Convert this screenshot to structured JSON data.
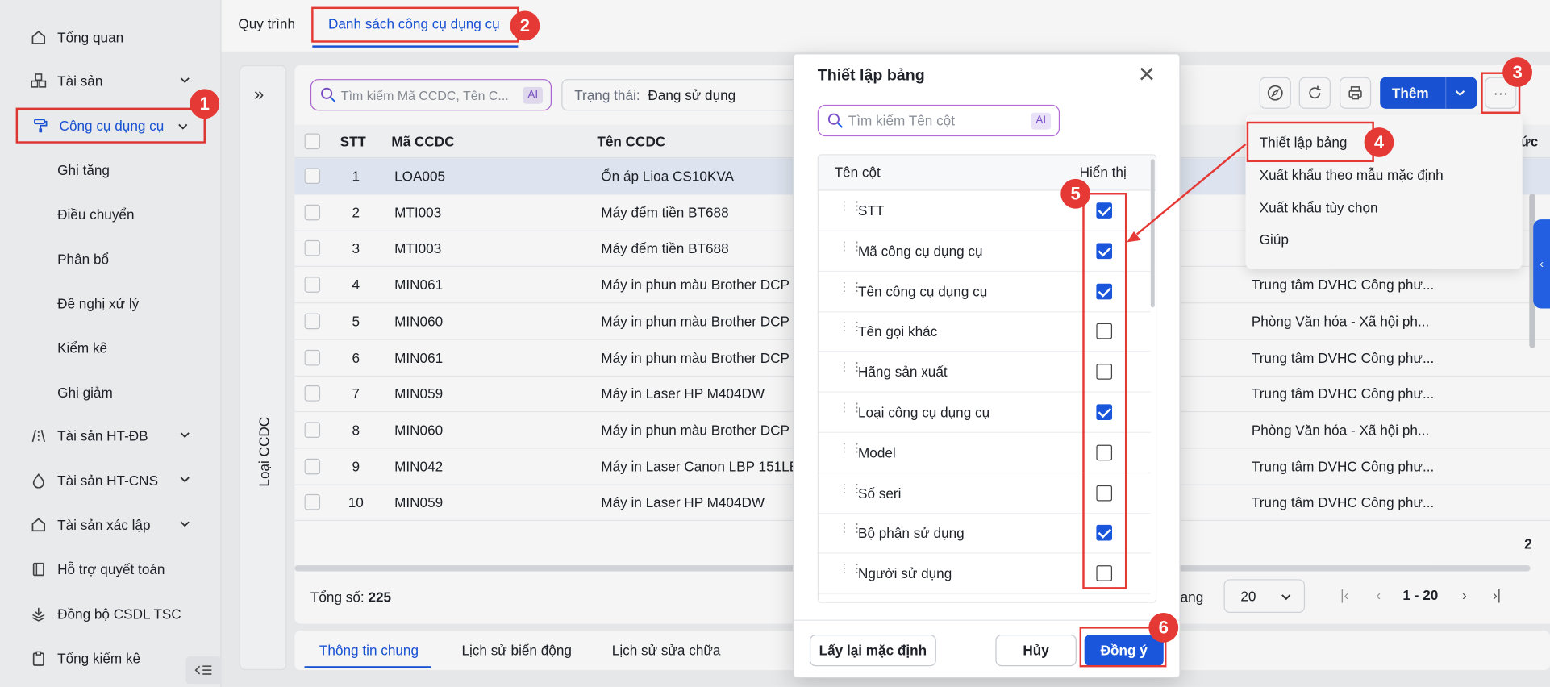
{
  "sidebar": {
    "items": [
      {
        "label": "Tổng quan",
        "icon": "home-icon"
      },
      {
        "label": "Tài sản",
        "icon": "cubes-icon"
      },
      {
        "label": "Công cụ dụng cụ",
        "icon": "paint-roller-icon"
      },
      {
        "label": "Ghi tăng"
      },
      {
        "label": "Điều chuyển"
      },
      {
        "label": "Phân bổ"
      },
      {
        "label": "Đề nghị xử lý"
      },
      {
        "label": "Kiểm kê"
      },
      {
        "label": "Ghi giảm"
      },
      {
        "label": "Tài sản HT-ĐB",
        "icon": "road-icon"
      },
      {
        "label": "Tài sản HT-CNS",
        "icon": "droplet-icon"
      },
      {
        "label": "Tài sản xác lập",
        "icon": "home-icon"
      },
      {
        "label": "Hỗ trợ quyết toán",
        "icon": "book-icon"
      },
      {
        "label": "Đồng bộ CSDL TSC",
        "icon": "layers-icon"
      },
      {
        "label": "Tổng kiểm kê",
        "icon": "clipboard-icon"
      }
    ]
  },
  "top_tabs": [
    "Quy trình",
    "Danh sách công cụ dụng cụ"
  ],
  "left_strip": {
    "label": "Loại CCDC"
  },
  "search": {
    "placeholder": "Tìm kiếm Mã CCDC, Tên C...",
    "ai": "AI"
  },
  "status_filter": {
    "label": "Trạng thái:",
    "value": "Đang sử dụng"
  },
  "table": {
    "headers": [
      "STT",
      "Mã CCDC",
      "Tên CCDC"
    ],
    "rows": [
      {
        "stt": "1",
        "code": "LOA005",
        "name": "Ổn áp Lioa CS10KVA",
        "dept": ""
      },
      {
        "stt": "2",
        "code": "MTI003",
        "name": "Máy đếm tiền BT688",
        "dept": ""
      },
      {
        "stt": "3",
        "code": "MTI003",
        "name": "Máy đếm tiền BT688",
        "dept": ""
      },
      {
        "stt": "4",
        "code": "MIN061",
        "name": "Máy in phun màu Brother DCP",
        "dept": "Trung tâm DVHC Công phư..."
      },
      {
        "stt": "5",
        "code": "MIN060",
        "name": "Máy in phun màu Brother DCP",
        "dept": "Phòng Văn hóa - Xã hội ph..."
      },
      {
        "stt": "6",
        "code": "MIN061",
        "name": "Máy in phun màu Brother DCP",
        "dept": "Trung tâm DVHC Công phư..."
      },
      {
        "stt": "7",
        "code": "MIN059",
        "name": "Máy in Laser HP M404DW",
        "dept": "Trung tâm DVHC Công phư..."
      },
      {
        "stt": "8",
        "code": "MIN060",
        "name": "Máy in phun màu Brother DCP",
        "dept": "Phòng Văn hóa - Xã hội ph..."
      },
      {
        "stt": "9",
        "code": "MIN042",
        "name": "Máy in Laser Canon LBP 151LE",
        "dept": "Trung tâm DVHC Công phư..."
      },
      {
        "stt": "10",
        "code": "MIN059",
        "name": "Máy in Laser HP M404DW",
        "dept": "Trung tâm DVHC Công phư..."
      }
    ],
    "edge_text_top": "ức",
    "edge_text_bottom": "2"
  },
  "footer": {
    "total_label": "Tổng số:",
    "total_value": "225",
    "page_size_label": "ang",
    "page_size": "20",
    "range": "1 - 20"
  },
  "bottom_tabs": [
    "Thông tin chung",
    "Lịch sử biến động",
    "Lịch sử sửa chữa"
  ],
  "toolbar": {
    "add_label": "Thêm",
    "more": "···"
  },
  "dropdown": {
    "items": [
      "Thiết lập bảng",
      "Xuất khẩu theo mẫu mặc định",
      "Xuất khẩu tùy chọn",
      "Giúp"
    ]
  },
  "modal": {
    "title": "Thiết lập bảng",
    "search_placeholder": "Tìm kiếm Tên cột",
    "ai": "AI",
    "col_header": "Tên cột",
    "show_header": "Hiển thị",
    "columns": [
      {
        "name": "STT",
        "checked": true
      },
      {
        "name": "Mã công cụ dụng cụ",
        "checked": true
      },
      {
        "name": "Tên công cụ dụng cụ",
        "checked": true
      },
      {
        "name": "Tên gọi khác",
        "checked": false
      },
      {
        "name": "Hãng sản xuất",
        "checked": false
      },
      {
        "name": "Loại công cụ dụng cụ",
        "checked": true
      },
      {
        "name": "Model",
        "checked": false
      },
      {
        "name": "Số seri",
        "checked": false
      },
      {
        "name": "Bộ phận sử dụng",
        "checked": true
      },
      {
        "name": "Người sử dụng",
        "checked": false
      }
    ],
    "reset_label": "Lấy lại mặc định",
    "cancel_label": "Hủy",
    "ok_label": "Đồng ý"
  },
  "badges": [
    "1",
    "2",
    "3",
    "4",
    "5",
    "6"
  ],
  "colors": {
    "accent": "#1a56db",
    "highlight": "#e53935"
  }
}
